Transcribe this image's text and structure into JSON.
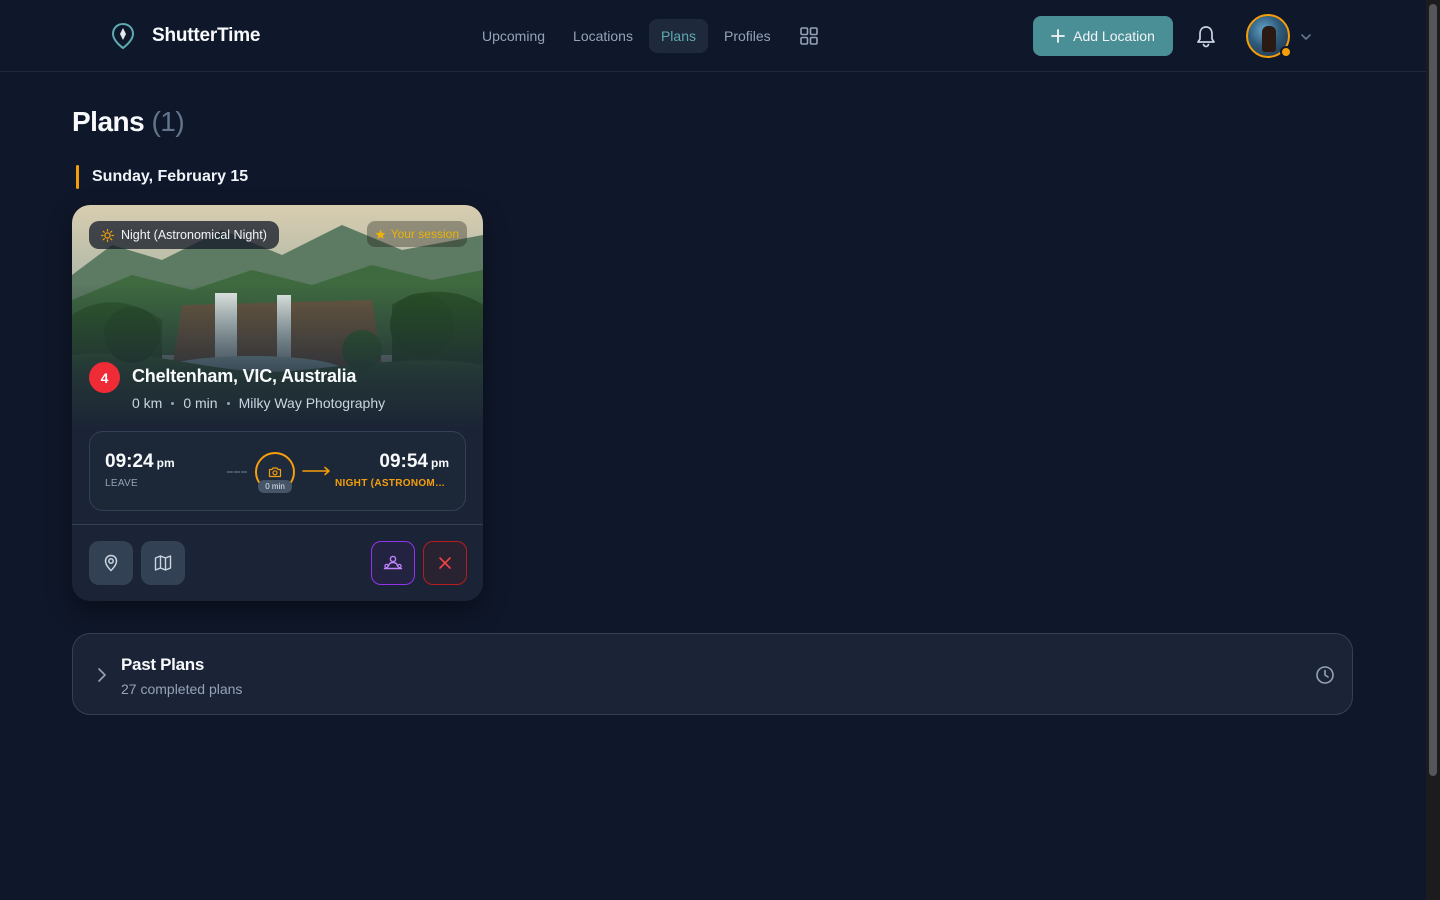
{
  "app": {
    "name": "ShutterTime"
  },
  "nav": {
    "items": [
      {
        "label": "Upcoming",
        "active": false
      },
      {
        "label": "Locations",
        "active": false
      },
      {
        "label": "Plans",
        "active": true
      },
      {
        "label": "Profiles",
        "active": false
      }
    ],
    "apps_icon": "grid-icon"
  },
  "header": {
    "add_location_label": "Add Location",
    "notifications_icon": "bell-icon",
    "avatar_badge_color": "#f59e0b"
  },
  "page": {
    "title": "Plans",
    "count": "(1)",
    "date_heading": "Sunday, February 15"
  },
  "plan_card": {
    "phase_badge": "Night (Astronomical Night)",
    "session_tag": "Your session",
    "rank": "4",
    "location": "Cheltenham, VIC, Australia",
    "distance": "0 km",
    "travel_time": "0 min",
    "category": "Milky Way Photography",
    "leave_time": "09:24",
    "leave_suffix": "pm",
    "leave_label": "LEAVE",
    "shoot_duration": "0 min",
    "arrive_time": "09:54",
    "arrive_suffix": "pm",
    "arrive_label": "NIGHT (ASTRONOMICAL NIGHT)"
  },
  "past_plans": {
    "title": "Past Plans",
    "subtitle": "27 completed plans"
  },
  "colors": {
    "background": "#0f172a",
    "card": "#1b2436",
    "accent_teal": "#4b8f96",
    "accent_amber": "#f59e0b",
    "rank_red": "#ef2b36"
  }
}
